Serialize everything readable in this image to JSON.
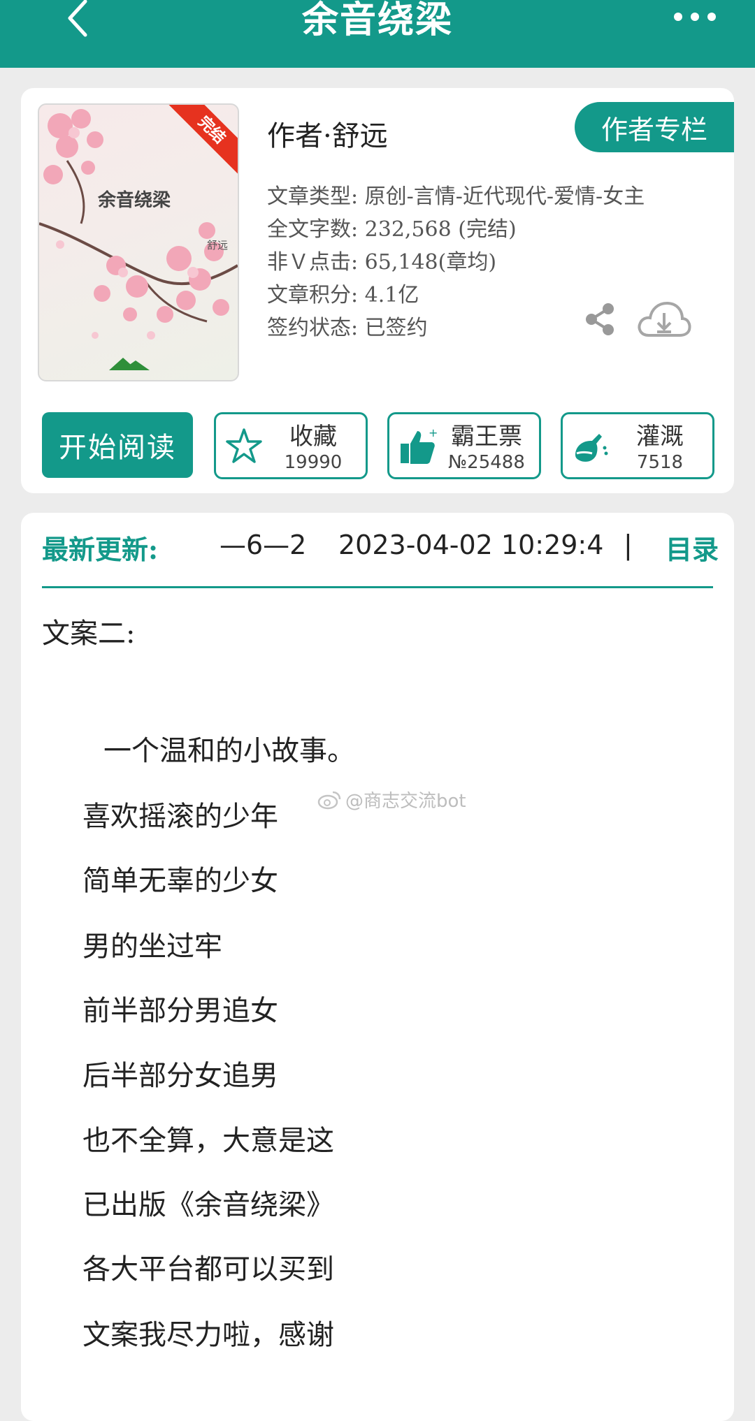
{
  "header": {
    "title": "余音绕梁"
  },
  "book": {
    "cover_title": "余音绕梁",
    "cover_author": "舒远",
    "cover_badge": "完结",
    "author_line": "作者·舒远",
    "author_column_label": "作者专栏",
    "info": [
      "文章类型: 原创-言情-近代现代-爱情-女主",
      "全文字数: 232,568 (完结)",
      "非Ｖ点击: 65,148(章均)",
      "文章积分: 4.1亿",
      "签约状态: 已签约"
    ]
  },
  "actions": {
    "read_label": "开始阅读",
    "collect": {
      "label": "收藏",
      "value": "19990"
    },
    "vote": {
      "label": "霸王票",
      "value": "№25488"
    },
    "water": {
      "label": "灌溉",
      "value": "7518"
    }
  },
  "update": {
    "label": "最新更新:",
    "chapter": "—6—2",
    "time": "2023-04-02 10:29:4",
    "separator": "|",
    "toc_label": "目录"
  },
  "watermark": "@商志交流bot",
  "intro": {
    "heading": "文案二:",
    "lines": [
      "一个温和的小故事。",
      "喜欢摇滚的少年",
      "简单无辜的少女",
      "男的坐过牢",
      "前半部分男追女",
      "后半部分女追男",
      "也不全算，大意是这",
      "已出版《余音绕梁》",
      "各大平台都可以买到",
      "文案我尽力啦，感谢"
    ]
  },
  "colors": {
    "accent": "#13998a",
    "badge": "#e6321f",
    "background": "#ececec"
  }
}
